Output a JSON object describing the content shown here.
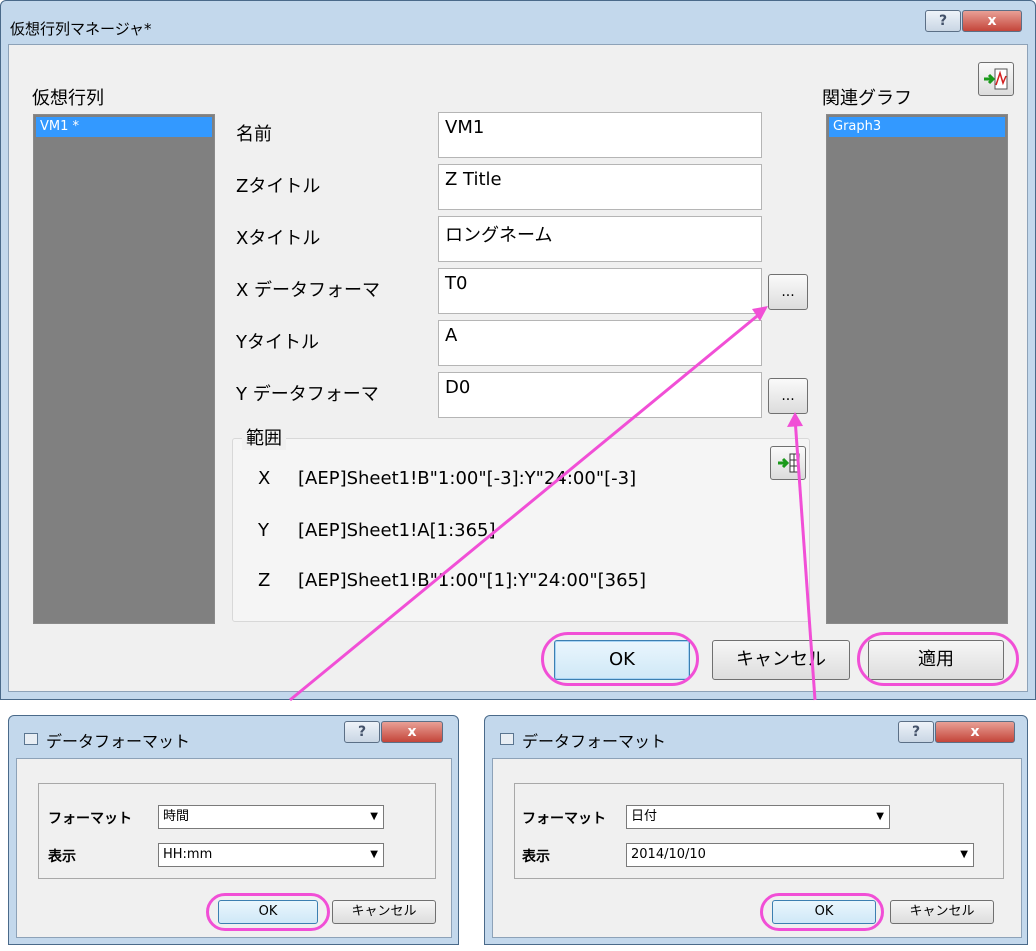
{
  "main": {
    "title": "仮想行列マネージャ*",
    "help_label": "?",
    "close_label": "x",
    "matrices_label": "仮想行列",
    "matrices": [
      "VM1 *"
    ],
    "name_label": "名前",
    "name_value": "VM1",
    "ztitle_label": "Zタイトル",
    "ztitle_value": "Z Title",
    "xtitle_label": "Xタイトル",
    "xtitle_value": "ロングネーム",
    "xformat_label": "X データフォーマ",
    "xformat_value": "T0",
    "ytitle_label": "Yタイトル",
    "ytitle_value": "A",
    "yformat_label": "Y データフォーマ",
    "yformat_value": "D0",
    "browse_label": "...",
    "range_label": "範囲",
    "range": {
      "x_axis": "X",
      "x_value": "[AEP]Sheet1!B\"1:00\"[-3]:Y\"24:00\"[-3]",
      "y_axis": "Y",
      "y_value": "[AEP]Sheet1!A[1:365]",
      "z_axis": "Z",
      "z_value": "[AEP]Sheet1!B\"1:00\"[1]:Y\"24:00\"[365]"
    },
    "graphs_label": "関連グラフ",
    "graphs": [
      "Graph3"
    ],
    "ok_label": "OK",
    "cancel_label": "キャンセル",
    "apply_label": "適用"
  },
  "dialog_left": {
    "title": "データフォーマット",
    "help_label": "?",
    "close_label": "x",
    "format_label": "フォーマット",
    "format_value": "時間",
    "display_label": "表示",
    "display_value": "HH:mm",
    "ok_label": "OK",
    "cancel_label": "キャンセル"
  },
  "dialog_right": {
    "title": "データフォーマット",
    "help_label": "?",
    "close_label": "x",
    "format_label": "フォーマット",
    "format_value": "日付",
    "display_label": "表示",
    "display_value": "2014/10/10",
    "ok_label": "OK",
    "cancel_label": "キャンセル"
  },
  "colors": {
    "highlight": "#f14fd6",
    "selection": "#3399ff",
    "title_bar": "#c3d8ec"
  }
}
